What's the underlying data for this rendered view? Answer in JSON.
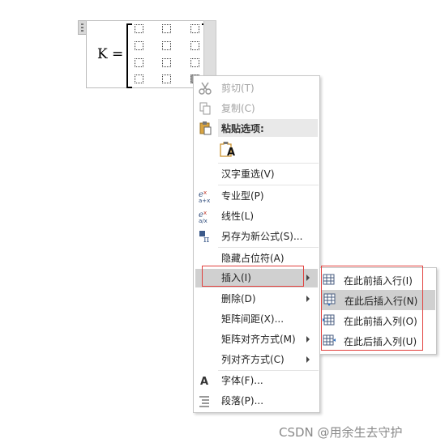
{
  "equation": {
    "variable": "K",
    "equals": "="
  },
  "menu": {
    "cut": "剪切(T)",
    "copy": "复制(C)",
    "paste_header": "粘贴选项:",
    "paste_icon": "A",
    "reconvert": "汉字重选(V)",
    "professional": "专业型(P)",
    "linear": "线性(L)",
    "save_as_new": "另存为新公式(S)...",
    "hide_placeholder": "隐藏占位符(A)",
    "insert": "插入(I)",
    "delete": "删除(D)",
    "matrix_spacing": "矩阵间距(X)...",
    "matrix_alignment": "矩阵对齐方式(M)",
    "column_alignment": "列对齐方式(C)",
    "font": "字体(F)...",
    "paragraph": "段落(P)..."
  },
  "submenu": {
    "insert_row_before": "在此前插入行(I)",
    "insert_row_after": "在此后插入行(N)",
    "insert_col_before": "在此前插入列(O)",
    "insert_col_after": "在此后插入列(U)"
  },
  "watermark": "CSDN @用余生去守护",
  "colors": {
    "highlight": "#d0d0d0",
    "annotation_red": "#e1403d",
    "disabled_text": "#a3a3a3"
  }
}
